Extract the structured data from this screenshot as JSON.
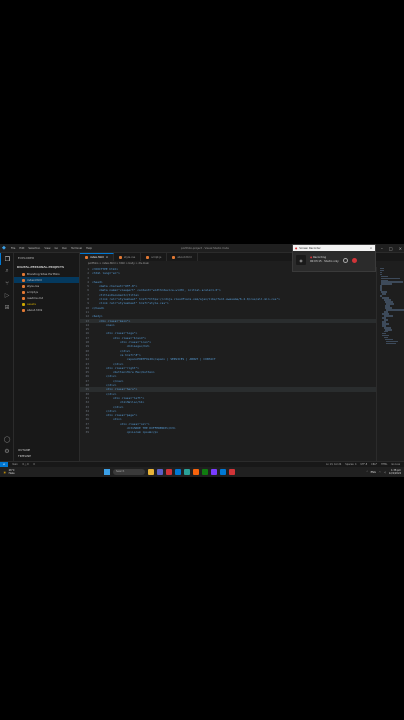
{
  "titlebar": {
    "menu": [
      "File",
      "Edit",
      "Selection",
      "View",
      "Go",
      "Run",
      "Terminal",
      "Help"
    ],
    "title": "portfolio-project - Visual Studio Code"
  },
  "sidebar": {
    "header": "EXPLORER",
    "section": "DIGITAL-PERSONAL-PROJECTS",
    "items": [
      {
        "label": "Branding Sites Portfolio",
        "state": "normal"
      },
      {
        "label": "index.html",
        "state": "selected"
      },
      {
        "label": "style.css",
        "state": "normal"
      },
      {
        "label": "script.js",
        "state": "normal"
      },
      {
        "label": "readme.md",
        "state": "normal"
      },
      {
        "label": "assets",
        "state": "warn"
      },
      {
        "label": "about.html",
        "state": "normal"
      }
    ],
    "footer": [
      "OUTLINE",
      "TIMELINE"
    ]
  },
  "tabs": [
    {
      "label": "index.html",
      "active": true
    },
    {
      "label": "style.css",
      "active": false
    },
    {
      "label": "script.js",
      "active": false
    },
    {
      "label": "about.html",
      "active": false
    }
  ],
  "breadcrumb": "portfolio > index.html > html > body > div.main",
  "code_lines": [
    {
      "n": "1",
      "text": "<!DOCTYPE html>"
    },
    {
      "n": "2",
      "text": "<html lang=\"en\">"
    },
    {
      "n": "3",
      "text": ""
    },
    {
      "n": "4",
      "text": "<head>"
    },
    {
      "n": "5",
      "text": "    <meta charset=\"UTF-8\">"
    },
    {
      "n": "6",
      "text": "    <meta name=\"viewport\" content=\"width=device-width, initial-scale=1.0\">"
    },
    {
      "n": "7",
      "text": "    <title>Document</title>"
    },
    {
      "n": "8",
      "text": "    <link rel=\"stylesheet\" href=\"https://cdnjs.cloudflare.com/ajax/libs/font-awesome/6.4.0/css/all.min.css\">"
    },
    {
      "n": "9",
      "text": "    <link rel=\"stylesheet\" href=\"style.css\">"
    },
    {
      "n": "10",
      "text": "</head>"
    },
    {
      "n": "11",
      "text": ""
    },
    {
      "n": "12",
      "text": "<body>"
    },
    {
      "n": "13",
      "text": "    <div class=\"main\">"
    },
    {
      "n": "14",
      "text": "        <nav>"
    },
    {
      "n": "15",
      "text": ""
    },
    {
      "n": "16",
      "text": "        <div class=\"logo\">"
    },
    {
      "n": "17",
      "text": "            <div class=\"brand\">"
    },
    {
      "n": "18",
      "text": "                <div class=\"icon\">"
    },
    {
      "n": "19",
      "text": "                    <h2>Logo</h2>"
    },
    {
      "n": "20",
      "text": "                </div>"
    },
    {
      "n": "21",
      "text": "                <a href=\"#\">"
    },
    {
      "n": "22",
      "text": "                    <span>PORTFOLIO</span> | SERVICES | ABOUT | CONTACT"
    },
    {
      "n": "23",
      "text": "            </div>"
    },
    {
      "n": "24",
      "text": "        <div class=\"right\">"
    },
    {
      "n": "25",
      "text": "            <button>Hire Me</button>"
    },
    {
      "n": "26",
      "text": "        </div>"
    },
    {
      "n": "27",
      "text": "            </nav>"
    },
    {
      "n": "28",
      "text": "        </div>"
    },
    {
      "n": "29",
      "text": "        <div class=\"hero\">"
    },
    {
      "n": "30",
      "text": "        </div>"
    },
    {
      "n": "31",
      "text": "            <div class=\"left\">"
    },
    {
      "n": "32",
      "text": "                <h1>Hello</h1>"
    },
    {
      "n": "33",
      "text": "            </div>"
    },
    {
      "n": "34",
      "text": "        </div>"
    },
    {
      "n": "35",
      "text": "        <div class=\"page\">"
    },
    {
      "n": "36",
      "text": "            <div>"
    },
    {
      "n": "37",
      "text": "                <div class=\"col\">"
    },
    {
      "n": "38",
      "text": "                    <h3>MAKE THE DIFFERENCE</h3>"
    },
    {
      "n": "39",
      "text": "                    <p>Lorem ipsum</p>"
    }
  ],
  "highlighted_lines": [
    "13",
    "29"
  ],
  "statusbar": {
    "left": [
      "main",
      "0 △ 0",
      "0"
    ],
    "right": [
      "Ln 13, Col 24",
      "Spaces: 4",
      "UTF-8",
      "CRLF",
      "HTML",
      "Go Live"
    ]
  },
  "taskbar": {
    "weather_temp": "26°C",
    "weather_desc": "Haze",
    "search_placeholder": "Search",
    "lang": "ENG",
    "time": "1:38 pm",
    "date": "12/2/2024",
    "app_colors": [
      "#e8b339",
      "#5b5fc7",
      "#d13438",
      "#0078d4",
      "#2aa198",
      "#f7630c",
      "#107c10",
      "#7a3cff",
      "#0078d4",
      "#d13438"
    ]
  },
  "recorder": {
    "title": "Screen Recorder",
    "status": "Recording",
    "time": "00:03:15",
    "mode": "Studio only"
  }
}
